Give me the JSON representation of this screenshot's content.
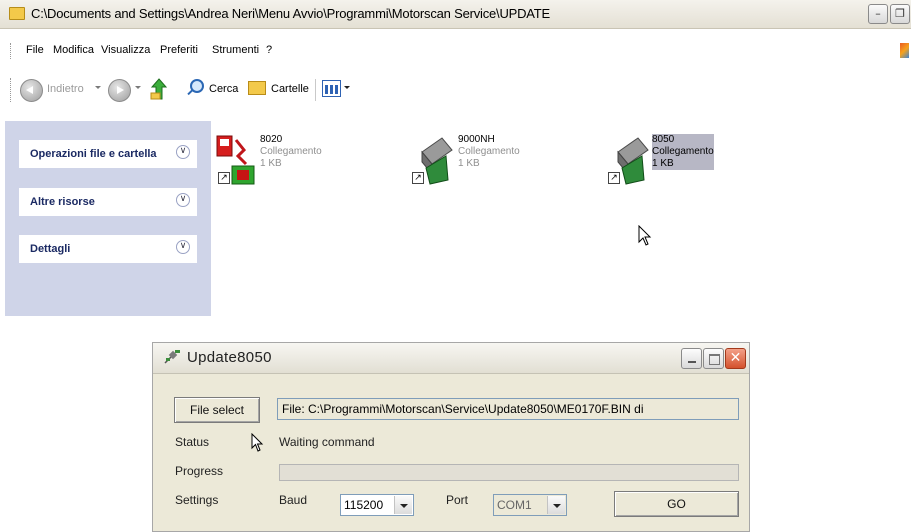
{
  "explorer": {
    "title": "C:\\Documents and Settings\\Andrea Neri\\Menu Avvio\\Programmi\\Motorscan Service\\UPDATE",
    "menu": [
      "File",
      "Modifica",
      "Visualizza",
      "Preferiti",
      "Strumenti",
      "?"
    ],
    "toolbar": {
      "back": "Indietro",
      "search": "Cerca",
      "folders": "Cartelle"
    },
    "taskpane": [
      {
        "label": "Operazioni file e cartella"
      },
      {
        "label": "Altre risorse"
      },
      {
        "label": "Dettagli"
      }
    ],
    "files": [
      {
        "name": "8020",
        "type": "Collegamento",
        "size": "1 KB",
        "selected": false,
        "icon": "red-device-icon"
      },
      {
        "name": "9000NH",
        "type": "Collegamento",
        "size": "1 KB",
        "selected": false,
        "icon": "gray-device-icon"
      },
      {
        "name": "8050",
        "type": "Collegamento",
        "size": "1 KB",
        "selected": true,
        "icon": "gray-device-icon"
      }
    ]
  },
  "dialog": {
    "title": "Update8050",
    "file_select_label": "File select",
    "file_path": "File: C:\\Programmi\\Motorscan\\Service\\Update8050\\ME0170F.BIN di",
    "status_label": "Status",
    "status_value": "Waiting command",
    "progress_label": "Progress",
    "progress_value": 0,
    "settings_label": "Settings",
    "baud_label": "Baud",
    "baud_value": "115200",
    "port_label": "Port",
    "port_value": "COM1",
    "go_label": "GO"
  },
  "colors": {
    "taskpane_bg": "#cfd4e8",
    "taskpane_text": "#1b2a63",
    "selection_bg": "#b7b7c5",
    "close_button": "#d4522d"
  }
}
